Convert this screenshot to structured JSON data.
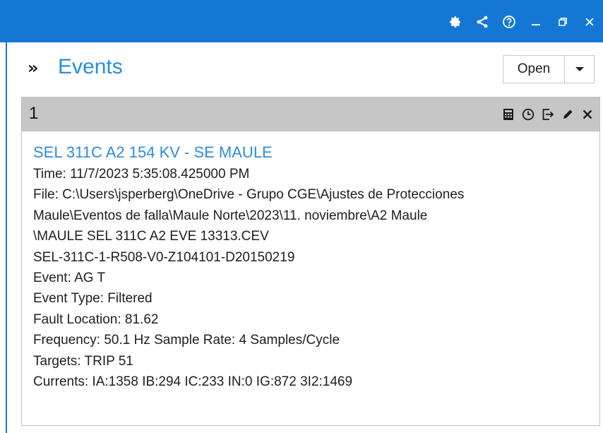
{
  "window": {
    "controls": [
      {
        "name": "settings-icon"
      },
      {
        "name": "share-icon"
      },
      {
        "name": "help-icon"
      },
      {
        "name": "minimize-icon"
      },
      {
        "name": "restore-icon"
      },
      {
        "name": "close-icon"
      }
    ]
  },
  "header": {
    "expand_glyph": "»",
    "title": "Events",
    "open_label": "Open"
  },
  "card": {
    "number": "1",
    "tools": [
      "calculator-icon",
      "clock-icon",
      "export-icon",
      "edit-icon",
      "close-icon"
    ],
    "event_title": "SEL 311C  A2 154 KV - SE MAULE",
    "lines": [
      "Time:  11/7/2023 5:35:08.425000 PM",
      "File: C:\\Users\\jsperberg\\OneDrive - Grupo CGE\\Ajustes de Protecciones",
      "Maule\\Eventos de falla\\Maule Norte\\2023\\11. noviembre\\A2 Maule",
      "\\MAULE SEL 311C A2 EVE 13313.CEV",
      "SEL-311C-1-R508-V0-Z104101-D20150219",
      "Event: AG T",
      "Event Type: Filtered",
      "Fault Location: 81.62",
      "Frequency: 50.1 Hz   Sample Rate: 4 Samples/Cycle",
      "Targets: TRIP 51",
      "Currents: IA:1358 IB:294 IC:233 IN:0 IG:872 3I2:1469"
    ]
  },
  "colors": {
    "titlebar": "#1477d4",
    "accent_text": "#2b8ddd",
    "card_header": "#c6c6c6"
  }
}
